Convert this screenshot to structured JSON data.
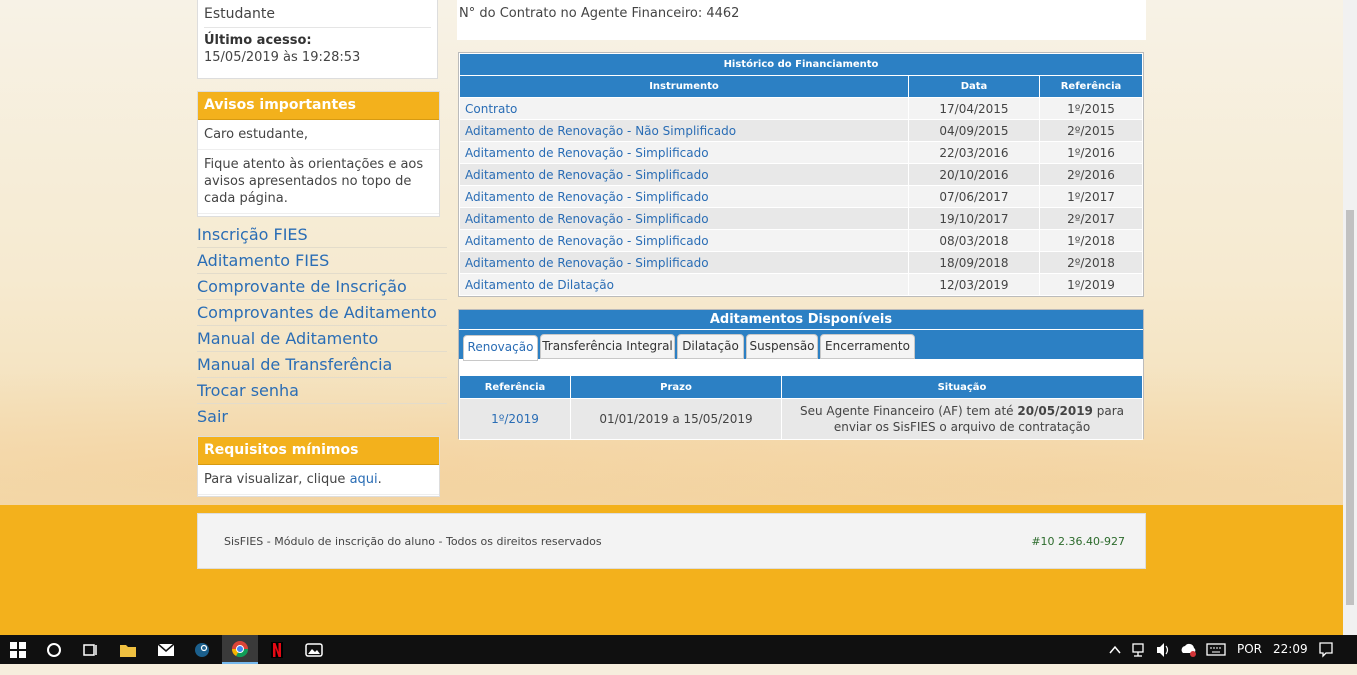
{
  "profile": {
    "role": "Estudante",
    "last_access_label": "Último acesso:",
    "last_access_value": "15/05/2019 às 19:28:53"
  },
  "avisos": {
    "title": "Avisos importantes",
    "greeting": "Caro estudante,",
    "message": "Fique atento às orientações e aos avisos apresentados no topo de cada página."
  },
  "nav": [
    "Inscrição FIES",
    "Aditamento FIES",
    "Comprovante de Inscrição",
    "Comprovantes de Aditamento",
    "Manual de Aditamento",
    "Manual de Transferência",
    "Trocar senha",
    "Sair"
  ],
  "requisitos": {
    "title": "Requisitos mínimos",
    "text": "Para visualizar, clique ",
    "link": "aqui",
    "tail": "."
  },
  "contract": {
    "line": "N° do Contrato no Agente Financeiro: 4462"
  },
  "historico": {
    "title": "Histórico do Financiamento",
    "headers": [
      "Instrumento",
      "Data",
      "Referência"
    ],
    "rows": [
      [
        "Contrato",
        "17/04/2015",
        "1º/2015"
      ],
      [
        "Aditamento de Renovação - Não Simplificado",
        "04/09/2015",
        "2º/2015"
      ],
      [
        "Aditamento de Renovação - Simplificado",
        "22/03/2016",
        "1º/2016"
      ],
      [
        "Aditamento de Renovação - Simplificado",
        "20/10/2016",
        "2º/2016"
      ],
      [
        "Aditamento de Renovação - Simplificado",
        "07/06/2017",
        "1º/2017"
      ],
      [
        "Aditamento de Renovação - Simplificado",
        "19/10/2017",
        "2º/2017"
      ],
      [
        "Aditamento de Renovação - Simplificado",
        "08/03/2018",
        "1º/2018"
      ],
      [
        "Aditamento de Renovação - Simplificado",
        "18/09/2018",
        "2º/2018"
      ],
      [
        "Aditamento de Dilatação",
        "12/03/2019",
        "1º/2019"
      ]
    ]
  },
  "aditamentos": {
    "title": "Aditamentos Disponíveis",
    "tabs": [
      "Renovação",
      "Transferência Integral",
      "Dilatação",
      "Suspensão",
      "Encerramento"
    ],
    "headers": [
      "Referência",
      "Prazo",
      "Situação"
    ],
    "row": {
      "referencia": "1º/2019",
      "prazo": "01/01/2019 a 15/05/2019",
      "situacao_pre": "Seu Agente Financeiro (AF) tem até ",
      "situacao_date": "20/05/2019",
      "situacao_post": " para enviar os SisFIES o arquivo de contratação"
    }
  },
  "footer": {
    "copyright": "SisFIES - Módulo de inscrição do aluno - Todos os direitos reservados",
    "version": "#10 2.36.40-927"
  },
  "taskbar": {
    "language": "POR",
    "time": "22:09",
    "icons": [
      "windows-start-icon",
      "cortana-icon",
      "task-view-icon",
      "file-explorer-icon",
      "mail-icon",
      "steam-icon",
      "chrome-icon",
      "netflix-icon",
      "photos-icon"
    ]
  }
}
